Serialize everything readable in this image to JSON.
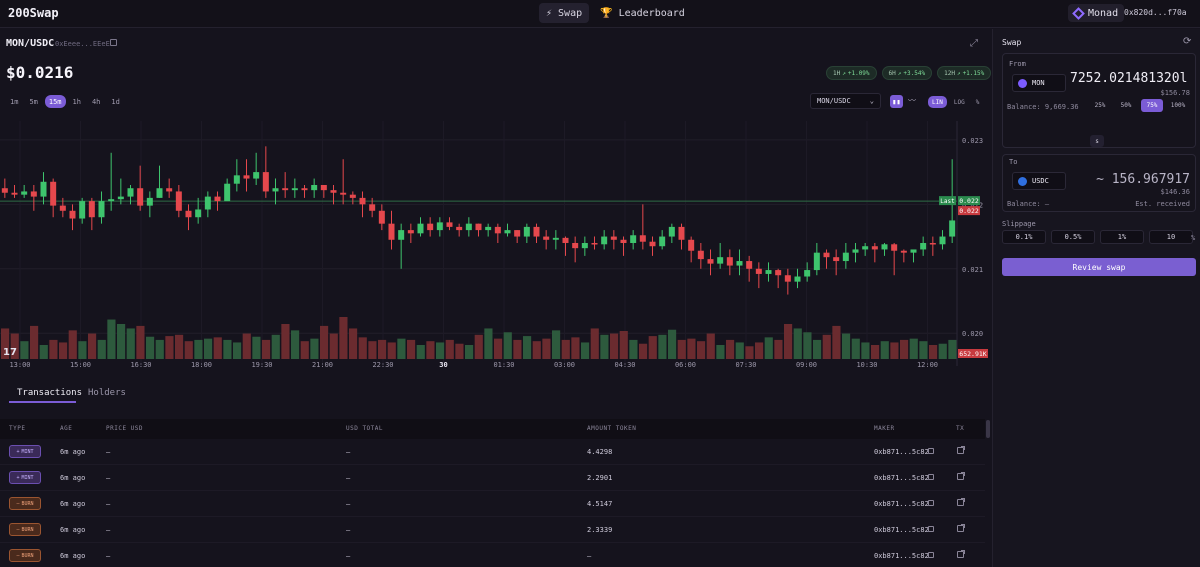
{
  "header": {
    "logo": "200Swap",
    "nav": [
      {
        "label": "Swap",
        "icon": "bolt-icon"
      },
      {
        "label": "Leaderboard",
        "icon": "trophy-icon"
      }
    ],
    "network": "Monad",
    "wallet": "0x820d...f70a"
  },
  "market": {
    "pair": "MON/USDC",
    "address": "0xEeee...EEeE",
    "price": "$0.0216",
    "changes": [
      {
        "label": "1H",
        "value": "+1.09%"
      },
      {
        "label": "6H",
        "value": "+3.54%"
      },
      {
        "label": "12H",
        "value": "+1.15%"
      }
    ],
    "timeframes": [
      "1m",
      "5m",
      "15m",
      "1h",
      "4h",
      "1d"
    ],
    "active_timeframe": "15m",
    "pair_select": "MON/USDC",
    "scales": [
      "LIN",
      "LOG",
      "%"
    ],
    "active_scale": "LIN"
  },
  "chart_data": {
    "type": "candlestick",
    "x_ticks": [
      "13:00",
      "15:00",
      "16:30",
      "18:00",
      "19:30",
      "21:00",
      "22:30",
      "30",
      "01:30",
      "03:00",
      "04:30",
      "06:00",
      "07:30",
      "09:00",
      "10:30",
      "12:00"
    ],
    "y_ticks": [
      "0.023",
      "0.022",
      "0.021",
      "0.020"
    ],
    "ylim": [
      0.0196,
      0.0232
    ],
    "last_label": "Last",
    "last_value": "0.022",
    "current_value": "0.022",
    "volume_label": "652.91K",
    "candles": [
      [
        0.02225,
        0.02218,
        0.0224,
        0.0221
      ],
      [
        0.02218,
        0.02215,
        0.0223,
        0.0221
      ],
      [
        0.02215,
        0.0222,
        0.0223,
        0.0221
      ],
      [
        0.0222,
        0.02212,
        0.0223,
        0.0219
      ],
      [
        0.02212,
        0.02235,
        0.0225,
        0.022
      ],
      [
        0.02235,
        0.02198,
        0.0224,
        0.0218
      ],
      [
        0.02198,
        0.0219,
        0.0221,
        0.0218
      ],
      [
        0.0219,
        0.02178,
        0.022,
        0.0216
      ],
      [
        0.02178,
        0.02205,
        0.0221,
        0.0217
      ],
      [
        0.02205,
        0.0218,
        0.0221,
        0.0216
      ],
      [
        0.0218,
        0.02205,
        0.0222,
        0.0217
      ],
      [
        0.02205,
        0.02208,
        0.0228,
        0.0219
      ],
      [
        0.02208,
        0.02212,
        0.0224,
        0.022
      ],
      [
        0.02212,
        0.02225,
        0.0223,
        0.022
      ],
      [
        0.02225,
        0.02198,
        0.0226,
        0.0219
      ],
      [
        0.02198,
        0.0221,
        0.0222,
        0.0218
      ],
      [
        0.0221,
        0.02225,
        0.0226,
        0.0221
      ],
      [
        0.02225,
        0.0222,
        0.0224,
        0.0221
      ],
      [
        0.0222,
        0.0219,
        0.0223,
        0.0218
      ],
      [
        0.0219,
        0.0218,
        0.022,
        0.0216
      ],
      [
        0.0218,
        0.02192,
        0.0221,
        0.0217
      ],
      [
        0.02192,
        0.02212,
        0.0222,
        0.0218
      ],
      [
        0.02212,
        0.02205,
        0.0222,
        0.0219
      ],
      [
        0.02205,
        0.02232,
        0.0224,
        0.0221
      ],
      [
        0.02232,
        0.02245,
        0.0227,
        0.0222
      ],
      [
        0.02245,
        0.0224,
        0.0227,
        0.0222
      ],
      [
        0.0224,
        0.0225,
        0.0228,
        0.0223
      ],
      [
        0.0225,
        0.0222,
        0.0229,
        0.0221
      ],
      [
        0.0222,
        0.02225,
        0.0224,
        0.022
      ],
      [
        0.02225,
        0.02222,
        0.0225,
        0.0221
      ],
      [
        0.02222,
        0.02225,
        0.0224,
        0.0221
      ],
      [
        0.02225,
        0.02222,
        0.0223,
        0.0221
      ],
      [
        0.02222,
        0.0223,
        0.0224,
        0.0221
      ],
      [
        0.0223,
        0.02222,
        0.0223,
        0.0221
      ],
      [
        0.02222,
        0.02218,
        0.0223,
        0.022
      ],
      [
        0.02218,
        0.02215,
        0.0227,
        0.022
      ],
      [
        0.02215,
        0.0221,
        0.0222,
        0.022
      ],
      [
        0.0221,
        0.022,
        0.0222,
        0.0218
      ],
      [
        0.022,
        0.0219,
        0.0221,
        0.0218
      ],
      [
        0.0219,
        0.0217,
        0.022,
        0.0216
      ],
      [
        0.0217,
        0.02145,
        0.0219,
        0.0213
      ],
      [
        0.02145,
        0.0216,
        0.0217,
        0.021
      ],
      [
        0.0216,
        0.02155,
        0.0217,
        0.0214
      ],
      [
        0.02155,
        0.0217,
        0.0218,
        0.0215
      ],
      [
        0.0217,
        0.0216,
        0.0218,
        0.0215
      ],
      [
        0.0216,
        0.02172,
        0.0218,
        0.0215
      ],
      [
        0.02172,
        0.02165,
        0.0218,
        0.0216
      ],
      [
        0.02165,
        0.0216,
        0.0217,
        0.0215
      ],
      [
        0.0216,
        0.0217,
        0.0218,
        0.0215
      ],
      [
        0.0217,
        0.0216,
        0.0217,
        0.0215
      ],
      [
        0.0216,
        0.02165,
        0.0217,
        0.0215
      ],
      [
        0.02165,
        0.02155,
        0.0217,
        0.0214
      ],
      [
        0.02155,
        0.0216,
        0.0217,
        0.0215
      ],
      [
        0.0216,
        0.0215,
        0.0216,
        0.0214
      ],
      [
        0.0215,
        0.02165,
        0.0217,
        0.0214
      ],
      [
        0.02165,
        0.0215,
        0.0217,
        0.0214
      ],
      [
        0.0215,
        0.02145,
        0.0216,
        0.0213
      ],
      [
        0.02145,
        0.02148,
        0.0216,
        0.0213
      ],
      [
        0.02148,
        0.0214,
        0.0215,
        0.0212
      ],
      [
        0.0214,
        0.02132,
        0.0215,
        0.0211
      ],
      [
        0.02132,
        0.0214,
        0.0215,
        0.0212
      ],
      [
        0.0214,
        0.02138,
        0.0215,
        0.0213
      ],
      [
        0.02138,
        0.0215,
        0.0216,
        0.0213
      ],
      [
        0.0215,
        0.02145,
        0.0216,
        0.0213
      ],
      [
        0.02145,
        0.0214,
        0.0215,
        0.0212
      ],
      [
        0.0214,
        0.02152,
        0.0216,
        0.0213
      ],
      [
        0.02152,
        0.02142,
        0.022,
        0.0213
      ],
      [
        0.02142,
        0.02135,
        0.0215,
        0.0212
      ],
      [
        0.02135,
        0.0215,
        0.0216,
        0.0213
      ],
      [
        0.0215,
        0.02165,
        0.0217,
        0.0214
      ],
      [
        0.02165,
        0.02145,
        0.0217,
        0.0213
      ],
      [
        0.02145,
        0.02128,
        0.0215,
        0.0211
      ],
      [
        0.02128,
        0.02115,
        0.0214,
        0.021
      ],
      [
        0.02115,
        0.02108,
        0.0213,
        0.0209
      ],
      [
        0.02108,
        0.02118,
        0.0214,
        0.021
      ],
      [
        0.02118,
        0.02105,
        0.0213,
        0.0209
      ],
      [
        0.02105,
        0.02112,
        0.0213,
        0.0209
      ],
      [
        0.02112,
        0.021,
        0.0212,
        0.0208
      ],
      [
        0.021,
        0.02092,
        0.0211,
        0.0207
      ],
      [
        0.02092,
        0.02098,
        0.0211,
        0.0208
      ],
      [
        0.02098,
        0.0209,
        0.021,
        0.0207
      ],
      [
        0.0209,
        0.0208,
        0.021,
        0.0206
      ],
      [
        0.0208,
        0.02088,
        0.021,
        0.0207
      ],
      [
        0.02088,
        0.02098,
        0.0211,
        0.0208
      ],
      [
        0.02098,
        0.02125,
        0.0214,
        0.0209
      ],
      [
        0.02125,
        0.02118,
        0.0213,
        0.021
      ],
      [
        0.02118,
        0.02112,
        0.0213,
        0.0209
      ],
      [
        0.02112,
        0.02125,
        0.0214,
        0.021
      ],
      [
        0.02125,
        0.0213,
        0.0214,
        0.0211
      ],
      [
        0.0213,
        0.02135,
        0.0214,
        0.0212
      ],
      [
        0.02135,
        0.0213,
        0.0214,
        0.0211
      ],
      [
        0.0213,
        0.02138,
        0.0214,
        0.0212
      ],
      [
        0.02138,
        0.02128,
        0.0214,
        0.0209
      ],
      [
        0.02128,
        0.02125,
        0.0213,
        0.0211
      ],
      [
        0.02125,
        0.0213,
        0.0213,
        0.0211
      ],
      [
        0.0213,
        0.0214,
        0.0215,
        0.0212
      ],
      [
        0.0214,
        0.02138,
        0.0215,
        0.0212
      ],
      [
        0.02138,
        0.0215,
        0.0216,
        0.0213
      ],
      [
        0.0215,
        0.02175,
        0.0227,
        0.0214
      ]
    ],
    "volumes": [
      48,
      40,
      28,
      52,
      22,
      30,
      26,
      45,
      28,
      40,
      30,
      62,
      55,
      48,
      52,
      35,
      30,
      36,
      38,
      28,
      30,
      32,
      34,
      30,
      26,
      40,
      35,
      30,
      38,
      55,
      45,
      28,
      32,
      52,
      40,
      66,
      48,
      34,
      28,
      30,
      26,
      32,
      30,
      22,
      28,
      26,
      30,
      24,
      22,
      38,
      48,
      32,
      42,
      30,
      36,
      28,
      32,
      45,
      30,
      34,
      26,
      48,
      38,
      40,
      44,
      30,
      24,
      36,
      38,
      46,
      30,
      32,
      28,
      40,
      22,
      30,
      26,
      20,
      26,
      34,
      30,
      55,
      48,
      42,
      30,
      38,
      52,
      40,
      32,
      26,
      22,
      28,
      26,
      30,
      32,
      28,
      22,
      24,
      30
    ]
  },
  "transactions": {
    "tabs": [
      "Transactions",
      "Holders"
    ],
    "active_tab": "Transactions",
    "columns": [
      "TYPE",
      "AGE",
      "PRICE USD",
      "USD TOTAL",
      "AMOUNT TOKEN",
      "MAKER",
      "TX"
    ],
    "rows": [
      {
        "type": "MINT",
        "age": "6m ago",
        "price": "—",
        "total": "—",
        "amount": "4.4298",
        "maker": "0xb871...5c82"
      },
      {
        "type": "MINT",
        "age": "6m ago",
        "price": "—",
        "total": "—",
        "amount": "2.2901",
        "maker": "0xb871...5c82"
      },
      {
        "type": "BURN",
        "age": "6m ago",
        "price": "—",
        "total": "—",
        "amount": "4.5147",
        "maker": "0xb871...5c82"
      },
      {
        "type": "BURN",
        "age": "6m ago",
        "price": "—",
        "total": "—",
        "amount": "2.3339",
        "maker": "0xb871...5c82"
      },
      {
        "type": "BURN",
        "age": "6m ago",
        "price": "—",
        "total": "—",
        "amount": "—",
        "maker": "0xb871...5c82"
      }
    ]
  },
  "swap": {
    "title": "Swap",
    "from_label": "From",
    "from_token": "MON",
    "from_amount": "7252.021481320l",
    "from_usd": "$156.78",
    "balance": "Balance: 9,669.36",
    "percents": [
      "25%",
      "50%",
      "75%",
      "100%"
    ],
    "active_percent": "75%",
    "switch": "s",
    "to_label": "To",
    "to_token": "USDC",
    "to_amount": "~ 156.967917",
    "to_usd": "$146.36",
    "to_balance": "Balance: —",
    "est_received": "Est. received",
    "slippage_label": "Slippage",
    "slippage": [
      "0.1%",
      "0.5%",
      "1%",
      "10"
    ],
    "slippage_suffix": "%",
    "review": "Review swap"
  },
  "colors": {
    "accent": "#7b5cd6",
    "up": "#3ec46d",
    "down": "#e5484d",
    "mon": "#7c5cff",
    "usdc": "#2f6fe0"
  }
}
